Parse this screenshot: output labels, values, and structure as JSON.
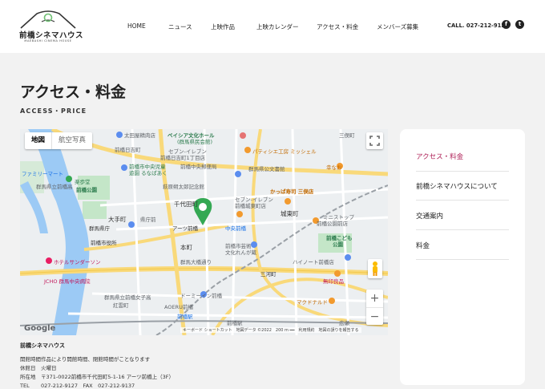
{
  "header": {
    "logo_text": "前橋シネマハウス",
    "logo_sub": "MAEBASHI CINEMA HOUSE",
    "nav": [
      "HOME",
      "ニュース",
      "上映作品",
      "上映カレンダー",
      "アクセス・料金",
      "メンバーズ募集"
    ],
    "call": "CALL. 027-212-9127",
    "social": [
      "f",
      "t"
    ]
  },
  "page": {
    "title": "アクセス・料金",
    "subtitle": "ACCESS・PRICE"
  },
  "map": {
    "type_buttons": [
      "地図",
      "航空写真"
    ],
    "zoom": [
      "+",
      "−"
    ],
    "google": "Google",
    "attribution": "キーボード ショートカット　地図データ ©2022　200 m ━━　利用規約　地図の誤りを報告する",
    "labels": {
      "l1": "太田屋精肉店",
      "l2": "ベイシア文化ホール",
      "l3": "(群馬県民会館)",
      "l4": "三俣町",
      "l5": "前橋日吉町",
      "l6": "パティシエ工房 ミッシェル",
      "l7": "セブン-イレブン",
      "l8": "前橋日吉町1丁目店",
      "l9": "ファミリーマート",
      "l10": "前橋市中央児童",
      "l11": "遊園 るなぱあく",
      "l12": "群馬県公文書館",
      "l13": "幸なお",
      "l14": "前橋中央郵便局",
      "l15": "群馬県立前橋高",
      "l16": "楽歩堂",
      "l17": "前橋公園",
      "l18": "萩原朔太郎記念館",
      "l19": "かっぱ寿司 三俣店",
      "l20": "千代田町",
      "l21": "セブン-イレブン",
      "l22": "前橋城東町店",
      "l23": "大手町",
      "l24": "県庁前",
      "l25": "城東町",
      "l26": "ミニストップ",
      "l27": "前橋公園前店",
      "l28": "群馬県庁",
      "l29": "アーツ前橋",
      "l30": "中央前橋",
      "l31": "前橋こども",
      "l32": "公園",
      "l33": "前橋市役所",
      "l34": "前橋市芸術",
      "l35": "文化れんが蔵",
      "l36": "ホテルサンダーソン",
      "l37": "本町",
      "l38": "ハイノート前橋店",
      "l39": "JCHO 群馬中央病院",
      "l40": "群馬大橋通り",
      "l41": "三河町",
      "l42": "無印良品",
      "l43": "群馬県立前橋女子高",
      "l44": "紅雲町",
      "l45": "ドーミーイン前橋",
      "l46": "マクドナルド",
      "l47": "AOERU前橋",
      "l48": "前橋駅",
      "l49": "前橋駅",
      "l50": "広瀬"
    }
  },
  "sidebar": {
    "items": [
      "アクセス・料金",
      "前橋シネマハウスについて",
      "交通案内",
      "料金"
    ]
  },
  "info": {
    "name": "前橋シネマハウス",
    "rows": [
      {
        "k": "開館時間",
        "v": "作品により開館時間、閉館時間がことなります"
      },
      {
        "k": "休館日",
        "v": "火曜日"
      },
      {
        "k": "所在地",
        "v": "〒371-0022前橋市千代田町5-1-16 アーツ前橋上（3F）"
      },
      {
        "k": "TEL",
        "v": "027-212-9127　FAX　027-212-9137"
      }
    ]
  },
  "colors": {
    "accent": "#b0245a",
    "pin": "#34a853",
    "river": "#9ccaf5",
    "park": "#c4e6c8"
  }
}
